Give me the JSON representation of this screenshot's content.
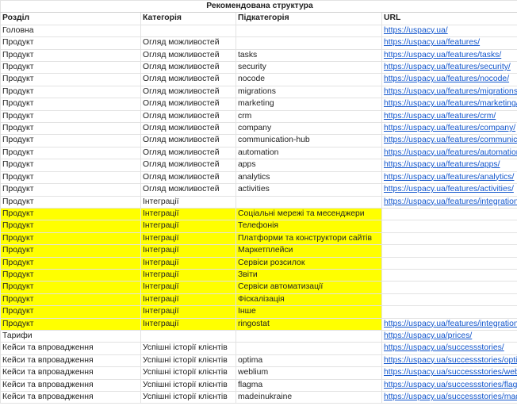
{
  "title": "Рекомендована структура",
  "headers": [
    "Розділ",
    "Категорія",
    "Підкатегорія",
    "URL"
  ],
  "highlight_color": "#ffff00",
  "rows": [
    {
      "section": "Головна",
      "category": "",
      "subcategory": "",
      "url": "https://uspacy.ua/",
      "hl": false
    },
    {
      "section": "Продукт",
      "category": "Огляд можливостей",
      "subcategory": "",
      "url": "https://uspacy.ua/features/",
      "hl": false
    },
    {
      "section": "Продукт",
      "category": "Огляд можливостей",
      "subcategory": "tasks",
      "url": "https://uspacy.ua/features/tasks/",
      "hl": false
    },
    {
      "section": "Продукт",
      "category": "Огляд можливостей",
      "subcategory": "security",
      "url": "https://uspacy.ua/features/security/",
      "hl": false
    },
    {
      "section": "Продукт",
      "category": "Огляд можливостей",
      "subcategory": "nocode",
      "url": "https://uspacy.ua/features/nocode/",
      "hl": false
    },
    {
      "section": "Продукт",
      "category": "Огляд можливостей",
      "subcategory": "migrations",
      "url": "https://uspacy.ua/features/migrations/",
      "hl": false
    },
    {
      "section": "Продукт",
      "category": "Огляд можливостей",
      "subcategory": "marketing",
      "url": "https://uspacy.ua/features/marketing/",
      "hl": false
    },
    {
      "section": "Продукт",
      "category": "Огляд можливостей",
      "subcategory": "crm",
      "url": "https://uspacy.ua/features/crm/",
      "hl": false
    },
    {
      "section": "Продукт",
      "category": "Огляд можливостей",
      "subcategory": "company",
      "url": "https://uspacy.ua/features/company/",
      "hl": false
    },
    {
      "section": "Продукт",
      "category": "Огляд можливостей",
      "subcategory": "communication-hub",
      "url": "https://uspacy.ua/features/communication-hub/",
      "hl": false
    },
    {
      "section": "Продукт",
      "category": "Огляд можливостей",
      "subcategory": "automation",
      "url": "https://uspacy.ua/features/automation/",
      "hl": false
    },
    {
      "section": "Продукт",
      "category": "Огляд можливостей",
      "subcategory": "apps",
      "url": "https://uspacy.ua/features/apps/",
      "hl": false
    },
    {
      "section": "Продукт",
      "category": "Огляд можливостей",
      "subcategory": "analytics",
      "url": "https://uspacy.ua/features/analytics/",
      "hl": false
    },
    {
      "section": "Продукт",
      "category": "Огляд можливостей",
      "subcategory": "activities",
      "url": "https://uspacy.ua/features/activities/",
      "hl": false
    },
    {
      "section": "Продукт",
      "category": "Інтеграції",
      "subcategory": "",
      "url": "https://uspacy.ua/features/integrations/",
      "hl": false
    },
    {
      "section": "Продукт",
      "category": "Інтеграції",
      "subcategory": "Соціальні мережі та месенджери",
      "url": "",
      "hl": true
    },
    {
      "section": "Продукт",
      "category": "Інтеграції",
      "subcategory": "Телефонія",
      "url": "",
      "hl": true
    },
    {
      "section": "Продукт",
      "category": "Інтеграції",
      "subcategory": "Платформи та конструктори сайтів",
      "url": "",
      "hl": true
    },
    {
      "section": "Продукт",
      "category": "Інтеграції",
      "subcategory": "Маркетплейси",
      "url": "",
      "hl": true
    },
    {
      "section": "Продукт",
      "category": "Інтеграції",
      "subcategory": "Сервіси розсилок",
      "url": "",
      "hl": true
    },
    {
      "section": "Продукт",
      "category": "Інтеграції",
      "subcategory": "Звіти",
      "url": "",
      "hl": true
    },
    {
      "section": "Продукт",
      "category": "Інтеграції",
      "subcategory": "Сервіси автоматизації",
      "url": "",
      "hl": true
    },
    {
      "section": "Продукт",
      "category": "Інтеграції",
      "subcategory": "Фіскалізація",
      "url": "",
      "hl": true
    },
    {
      "section": "Продукт",
      "category": "Інтеграції",
      "subcategory": "Інше",
      "url": "",
      "hl": true
    },
    {
      "section": "Продукт",
      "category": "Інтеграції",
      "subcategory": "ringostat",
      "url": "https://uspacy.ua/features/integrations/ringostat/",
      "hl": true
    },
    {
      "section": "Тарифи",
      "category": "",
      "subcategory": "",
      "url": "https://uspacy.ua/prices/",
      "hl": false
    },
    {
      "section": "Кейси та впровадження",
      "category": "Успішні історії клієнтів",
      "subcategory": "",
      "url": "https://uspacy.ua/successstories/",
      "hl": false
    },
    {
      "section": "Кейси та впровадження",
      "category": "Успішні історії клієнтів",
      "subcategory": "optima",
      "url": "https://uspacy.ua/successstories/optima/",
      "hl": false
    },
    {
      "section": "Кейси та впровадження",
      "category": "Успішні історії клієнтів",
      "subcategory": "weblium",
      "url": "https://uspacy.ua/successstories/weblium/",
      "hl": false
    },
    {
      "section": "Кейси та впровадження",
      "category": "Успішні історії клієнтів",
      "subcategory": "flagma",
      "url": "https://uspacy.ua/successstories/flagma/",
      "hl": false
    },
    {
      "section": "Кейси та впровадження",
      "category": "Успішні історії клієнтів",
      "subcategory": "madeinukraine",
      "url": "https://uspacy.ua/successstories/madeinukraine/",
      "hl": false
    }
  ]
}
